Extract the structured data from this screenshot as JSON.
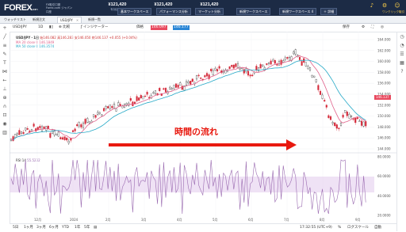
{
  "header": {
    "logo": "FOREX",
    "logo_suffix": ".com",
    "logo_sub_line1": "FX取引口座",
    "logo_sub_line2": "Forex.com ジャパン",
    "logo_sub_line3": "口座",
    "quotes": [
      {
        "value": "¥121,420",
        "label": "有効証拠金"
      },
      {
        "value": "¥121,420",
        "label": "口座残高"
      },
      {
        "value": "¥121,420",
        "label": "証拠金維持率"
      }
    ],
    "icon_label": "ワンクリック取引"
  },
  "workspaces": [
    "基本ワークスペース",
    "パフォーマンス分析",
    "マーケット分析",
    "新規ワークスペース",
    "新規ワークスペース 4",
    "＋ 詳細"
  ],
  "tabs": [
    "ウォッチリスト",
    "新規注文",
    "USD/JPY",
    "新規一覧"
  ],
  "toolbar": {
    "symbol": "USD/JPY",
    "timeframe": "1D",
    "compare": "比較",
    "indicators": "インジケーター",
    "mode": "価格",
    "bid": "146.097",
    "ask": "146.177",
    "save": "保存"
  },
  "legends": {
    "title": "USD/JPY・1日",
    "ohlc": "始146.082 高146.283 安146.050 終146.137 +0.055 (+0.04%)",
    "ma20_label": "MA 20 close 0",
    "ma20_value": "146.1849",
    "ma50_label": "MA 50 close 0",
    "ma50_value": "146.3574",
    "rsi_label": "RSI 14",
    "rsi_value": "55.5232"
  },
  "annotation": "時間の流れ",
  "colors": {
    "up": "#1a1a1a",
    "down": "#d42a3a",
    "ma20": "#e0618a",
    "ma50": "#26a9c7",
    "arrow": "#e8190f",
    "rsi": "#9a6ab0"
  },
  "chart_data": {
    "type": "line",
    "series": [
      {
        "name": "MA 20 close 0"
      },
      {
        "name": "MA 50 close 0"
      }
    ],
    "price_ticks": [
      "144.000",
      "146.000",
      "148.000",
      "150.000",
      "152.000",
      "154.000",
      "156.000",
      "158.000",
      "160.000",
      "162.000",
      "164.000"
    ],
    "time_ticks": [
      "12月",
      "2024",
      "2月",
      "3月",
      "4月",
      "5月",
      "6月",
      "7月",
      "8月",
      "9月"
    ],
    "rsi_ticks": [
      "80.0000",
      "60.0000",
      "40.0000",
      "20.0000"
    ],
    "last_price": "146.137"
  },
  "bottombar": {
    "ranges": [
      "5日",
      "1ヶ月",
      "3ヶ月",
      "6ヶ月",
      "YTD",
      "1年",
      "5年"
    ],
    "time": "17:32:55 (UTC+9)",
    "percent": "%",
    "log": "ログスケール",
    "auto": "自動"
  }
}
